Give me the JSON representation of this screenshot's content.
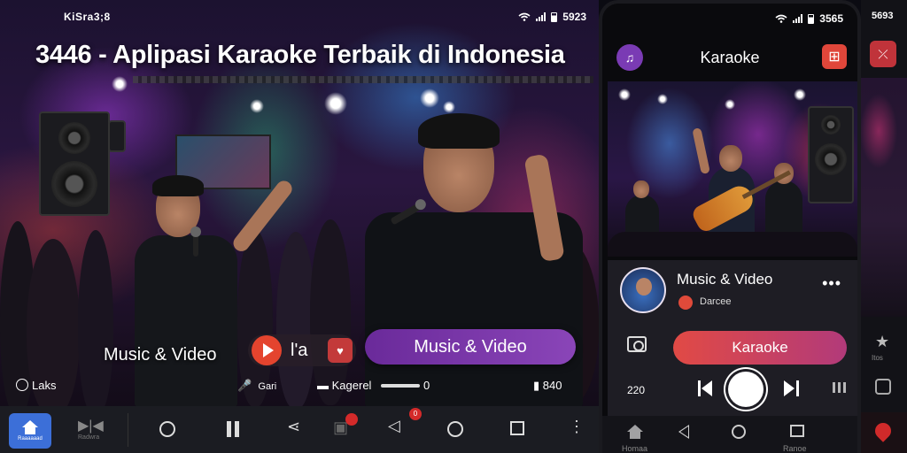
{
  "left": {
    "status_time": "KiSra3;8",
    "status_right": "5923",
    "headline": "3446 - Aplipasi Karaoke Terbaik di Indonesia",
    "music_video_label": "Music & Video",
    "mini_player_text": "l'a",
    "music_video_button": "Music & Video",
    "info_row": {
      "left": "Laks",
      "mid1": "Gari",
      "mid2": "Kagerel",
      "mid2_suffix": "0",
      "right": "840"
    },
    "nav": {
      "home_caption": "Raaaaaad",
      "second_caption": "Radwra",
      "badge": "0"
    }
  },
  "phone": {
    "status_right": "3565",
    "title": "Karaoke",
    "track_title": "Music & Video",
    "track_sub": "Darcee",
    "more": "•••",
    "karaoke_button": "Karaoke",
    "time": "220",
    "nav": {
      "home_caption": "Homaa",
      "recent_caption": "Ranoe"
    }
  },
  "edge": {
    "status": "5693",
    "item_caption": "Itos"
  },
  "colors": {
    "accent_purple": "#7a3bb4",
    "accent_red": "#e0463a",
    "nav_home_blue": "#3c6fd8"
  }
}
